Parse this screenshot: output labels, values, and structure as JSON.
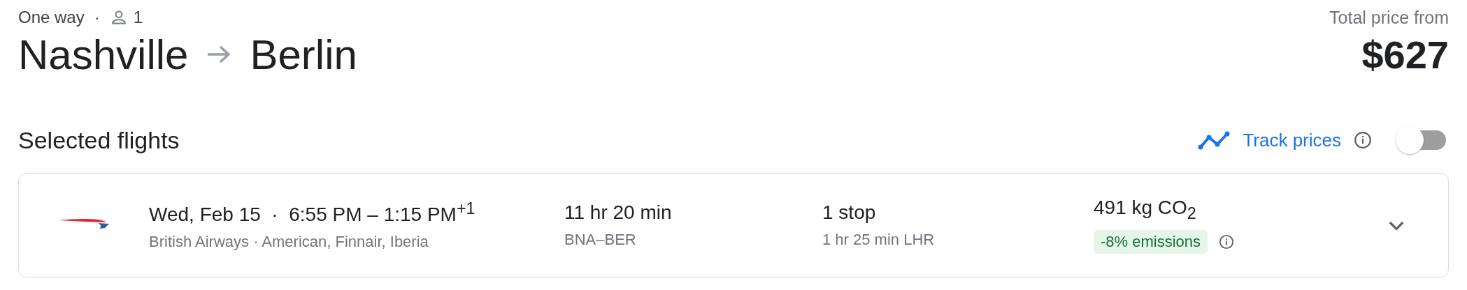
{
  "trip": {
    "type": "One way",
    "separator": "·",
    "passengers": "1",
    "origin": "Nashville",
    "destination": "Berlin"
  },
  "price": {
    "label": "Total price from",
    "amount": "$627"
  },
  "selected_flights": {
    "title": "Selected flights",
    "track_prices": {
      "label": "Track prices",
      "on": false
    }
  },
  "flights": [
    {
      "times": "Wed, Feb 15  ·  6:55 PM – 1:15 PM$^{+1}$",
      "airlines": "British Airways · American, Finnair, Iberia",
      "duration": "11 hr 20 min",
      "route": "BNA–BER",
      "stops": "1 stop",
      "layover": "1 hr 25 min LHR",
      "emissions": "491 kg CO$_{2}$",
      "emissions_badge": "-8% emissions",
      "expanded": false
    }
  ]
}
